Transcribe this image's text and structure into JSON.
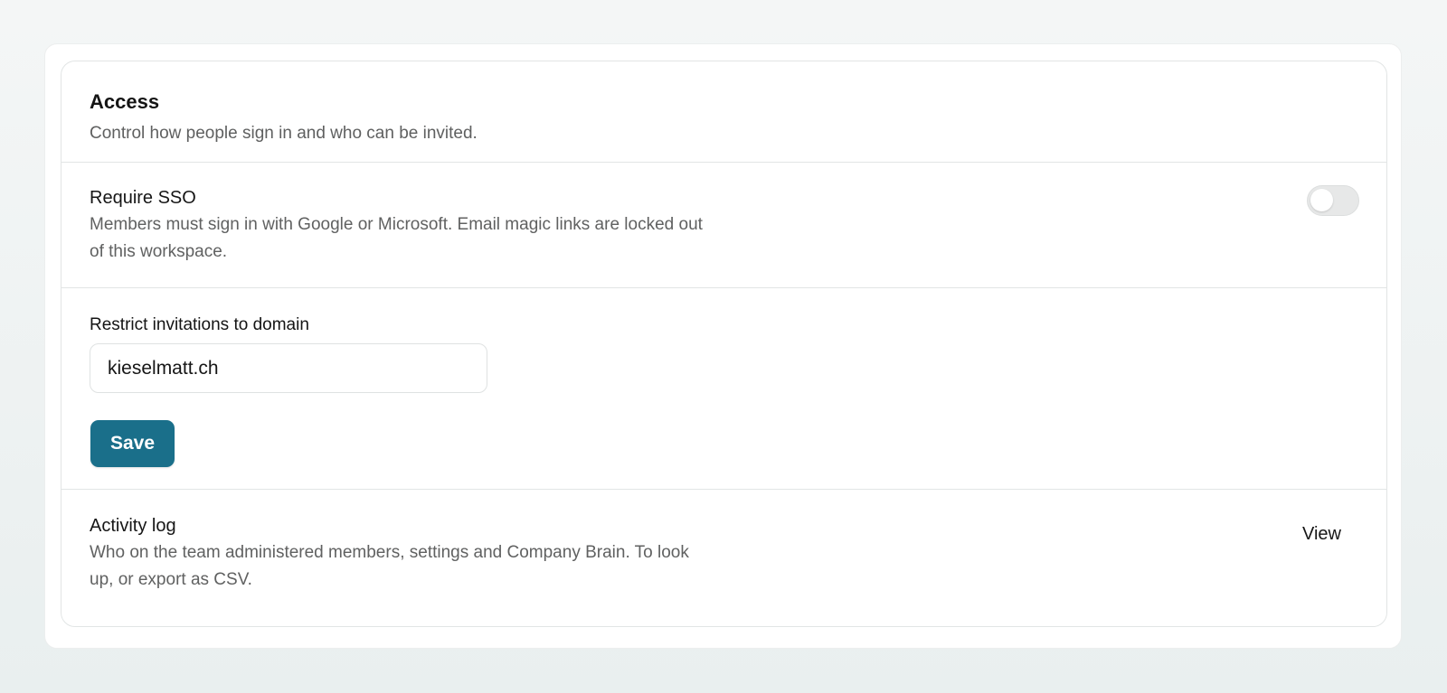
{
  "access": {
    "title": "Access",
    "description": "Control how people sign in and who can be invited."
  },
  "require_sso": {
    "title": "Require SSO",
    "description": "Members must sign in with Google or Microsoft. Email magic links are locked out of this workspace.",
    "enabled": false,
    "toggle_icon": "toggle-switch-icon"
  },
  "domain_restriction": {
    "label": "Restrict invitations to domain",
    "value": "kieselmatt.ch",
    "save_label": "Save"
  },
  "activity_log": {
    "title": "Activity log",
    "description": "Who on the team administered members, settings and Company Brain. To look up, or export as CSV.",
    "view_label": "View"
  },
  "colors": {
    "accent": "#1a6f8a",
    "background": "#eef2f2",
    "card": "#ffffff",
    "border": "#e2e5e5",
    "muted_text": "#606161"
  }
}
